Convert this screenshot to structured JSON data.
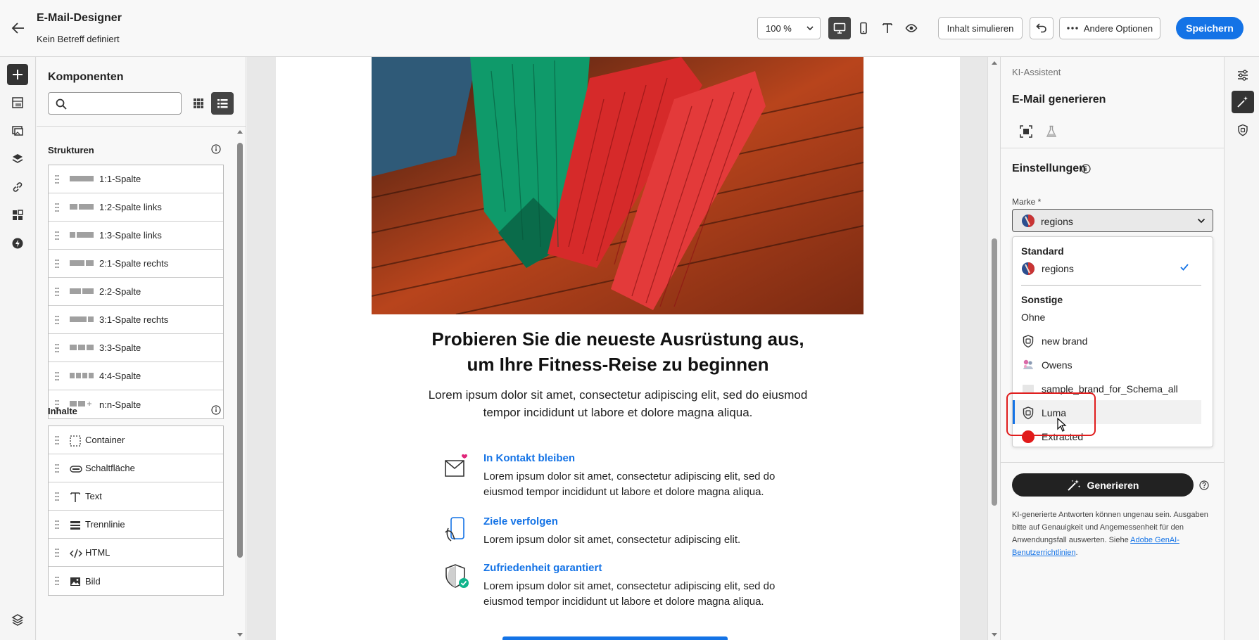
{
  "header": {
    "title": "E-Mail-Designer",
    "subtitle": "Kein Betreff definiert",
    "zoom": "100 %",
    "simulate_label": "Inhalt simulieren",
    "more_options_label": "Andere Optionen",
    "save_label": "Speichern"
  },
  "components": {
    "title": "Komponenten",
    "search_placeholder": "",
    "structures_heading": "Strukturen",
    "structures": [
      {
        "label": "1:1-Spalte"
      },
      {
        "label": "1:2-Spalte links"
      },
      {
        "label": "1:3-Spalte links"
      },
      {
        "label": "2:1-Spalte rechts"
      },
      {
        "label": "2:2-Spalte"
      },
      {
        "label": "3:1-Spalte rechts"
      },
      {
        "label": "3:3-Spalte"
      },
      {
        "label": "4:4-Spalte"
      },
      {
        "label": "n:n-Spalte"
      }
    ],
    "contents_heading": "Inhalte",
    "contents": [
      {
        "label": "Container",
        "icon": "container-icon"
      },
      {
        "label": "Schaltfläche",
        "icon": "button-icon"
      },
      {
        "label": "Text",
        "icon": "text-icon"
      },
      {
        "label": "Trennlinie",
        "icon": "divider-icon"
      },
      {
        "label": "HTML",
        "icon": "html-icon"
      },
      {
        "label": "Bild",
        "icon": "image-icon"
      }
    ]
  },
  "email": {
    "headline_line1": "Probieren Sie die neueste Ausrüstung aus,",
    "headline_line2": "um Ihre Fitness-Reise zu beginnen",
    "body": "Lorem ipsum dolor sit amet, consectetur adipiscing elit, sed do eiusmod tempor incididunt ut labore et dolore magna aliqua.",
    "features": [
      {
        "title": "In Kontakt bleiben",
        "text": "Lorem ipsum dolor sit amet, consectetur adipiscing elit, sed do eiusmod tempor incididunt ut labore et dolore magna aliqua.",
        "icon": "mail-heart-icon"
      },
      {
        "title": "Ziele verfolgen",
        "text": "Lorem ipsum dolor sit amet, consectetur adipiscing elit.",
        "icon": "phone-hand-icon"
      },
      {
        "title": "Zufriedenheit garantiert",
        "text": "Lorem ipsum dolor sit amet, consectetur adipiscing elit, sed do eiusmod tempor incididunt ut labore et dolore magna aliqua.",
        "icon": "shield-check-icon"
      }
    ]
  },
  "ai_panel": {
    "breadcrumb": "KI-Assistent",
    "title": "E-Mail generieren",
    "settings_heading": "Einstellungen",
    "brand_label": "Marke *",
    "brand_selected": "regions",
    "dropdown": {
      "group_standard": "Standard",
      "standard_option": "regions",
      "group_other": "Sonstige",
      "options": [
        {
          "label": "Ohne"
        },
        {
          "label": "new brand"
        },
        {
          "label": "Owens"
        },
        {
          "label": "sample_brand_for_Schema_all"
        },
        {
          "label": "Luma"
        },
        {
          "label": "Extracted"
        }
      ]
    },
    "generate_label": "Generieren",
    "disclaimer": "KI-generierte Antworten können ungenau sein. Ausgaben bitte auf Genauigkeit und Angemessenheit für den Anwendungsfall auswerten. Siehe ",
    "disclaimer_link": "Adobe GenAI-Benutzerrichtlinien",
    "disclaimer_end": "."
  },
  "colors": {
    "accent": "#1473e6",
    "highlight": "#e01d1d"
  }
}
